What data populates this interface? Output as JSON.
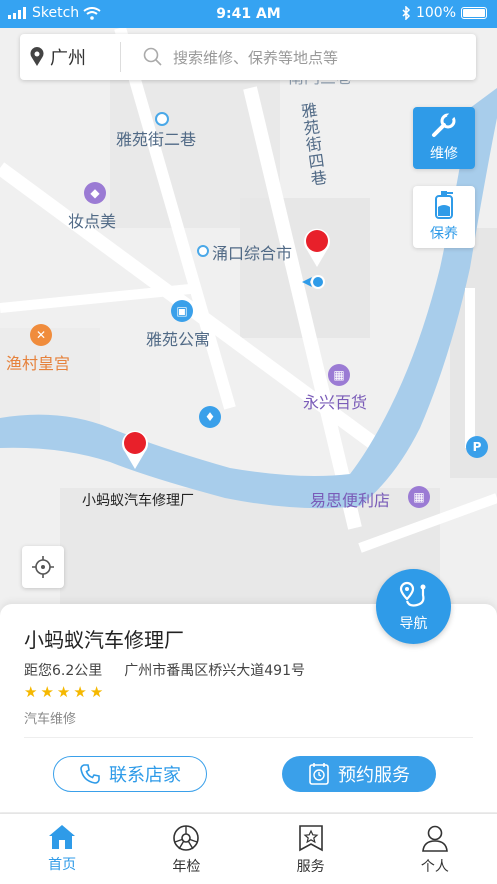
{
  "status": {
    "carrier": "Sketch",
    "time": "9:41 AM",
    "battery": "100%"
  },
  "search": {
    "city": "广州",
    "placeholder": "搜索维修、保养等地点等"
  },
  "side_buttons": {
    "repair": "维修",
    "maintain": "保养"
  },
  "map_labels": {
    "street1": "雅苑街二巷",
    "street2_lines": [
      "雅",
      "苑",
      "街",
      "四",
      "巷"
    ],
    "top_partial": "南门三巷",
    "poi_makeup": "妆点美",
    "poi_market": "涌口综合市",
    "poi_apartment": "雅苑公寓",
    "poi_restaurant": "渔村皇宫",
    "poi_department": "永兴百货",
    "poi_shop": "小蚂蚁汽车修理厂",
    "poi_convenience": "易思便利店",
    "parking": "P"
  },
  "nav_fab": {
    "label": "导航"
  },
  "card": {
    "name": "小蚂蚁汽车修理厂",
    "distance": "距您6.2公里",
    "address": "广州市番禺区桥兴大道491号",
    "rating": 5,
    "category": "汽车维修",
    "contact_label": "联系店家",
    "book_label": "预约服务"
  },
  "tabs": [
    {
      "label": "首页",
      "icon": "home-icon",
      "active": true
    },
    {
      "label": "年检",
      "icon": "wheel-icon",
      "active": false
    },
    {
      "label": "服务",
      "icon": "service-icon",
      "active": false
    },
    {
      "label": "个人",
      "icon": "person-icon",
      "active": false
    }
  ],
  "colors": {
    "accent": "#2f9be8",
    "river": "#a8cdeb",
    "marker": "#e8202a"
  }
}
